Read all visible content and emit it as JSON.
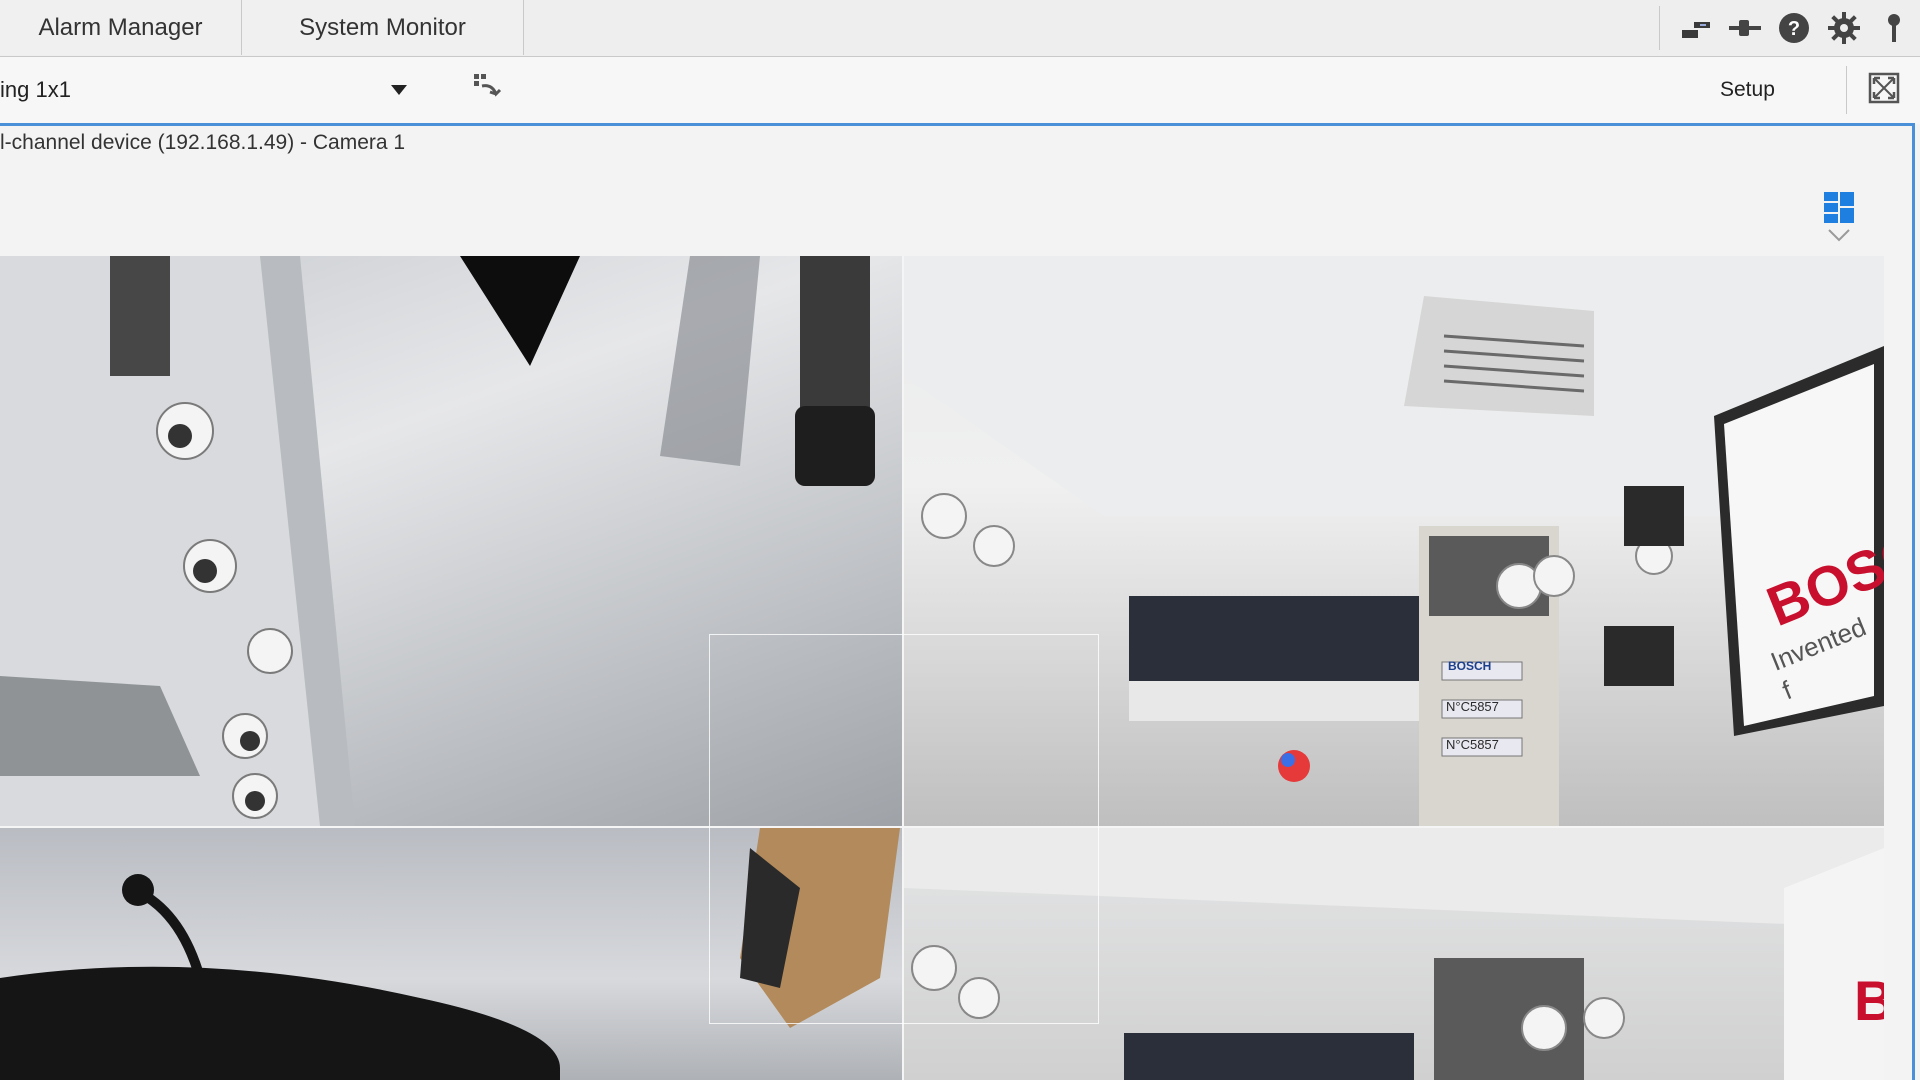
{
  "tabs": [
    {
      "label": "Alarm Manager"
    },
    {
      "label": "System Monitor"
    }
  ],
  "top_icons": [
    "network-icon",
    "connection-icon",
    "help-icon",
    "settings-icon",
    "pin-icon"
  ],
  "toolbar": {
    "layout_label": "ing 1x1",
    "setup_label": "Setup"
  },
  "camera": {
    "title": "l-channel device (192.168.1.49) - Camera 1"
  },
  "colors": {
    "accent": "#4a90d9",
    "grid_icon": "#1e7fe0"
  },
  "video_overlay": {
    "wall_sign": "BOSC",
    "wall_tagline": "Invented f",
    "door_sign": "BOSCH",
    "door_plate_1": "N°C5857",
    "door_plate_2": "N°C5857",
    "bottom_sign": "B"
  }
}
